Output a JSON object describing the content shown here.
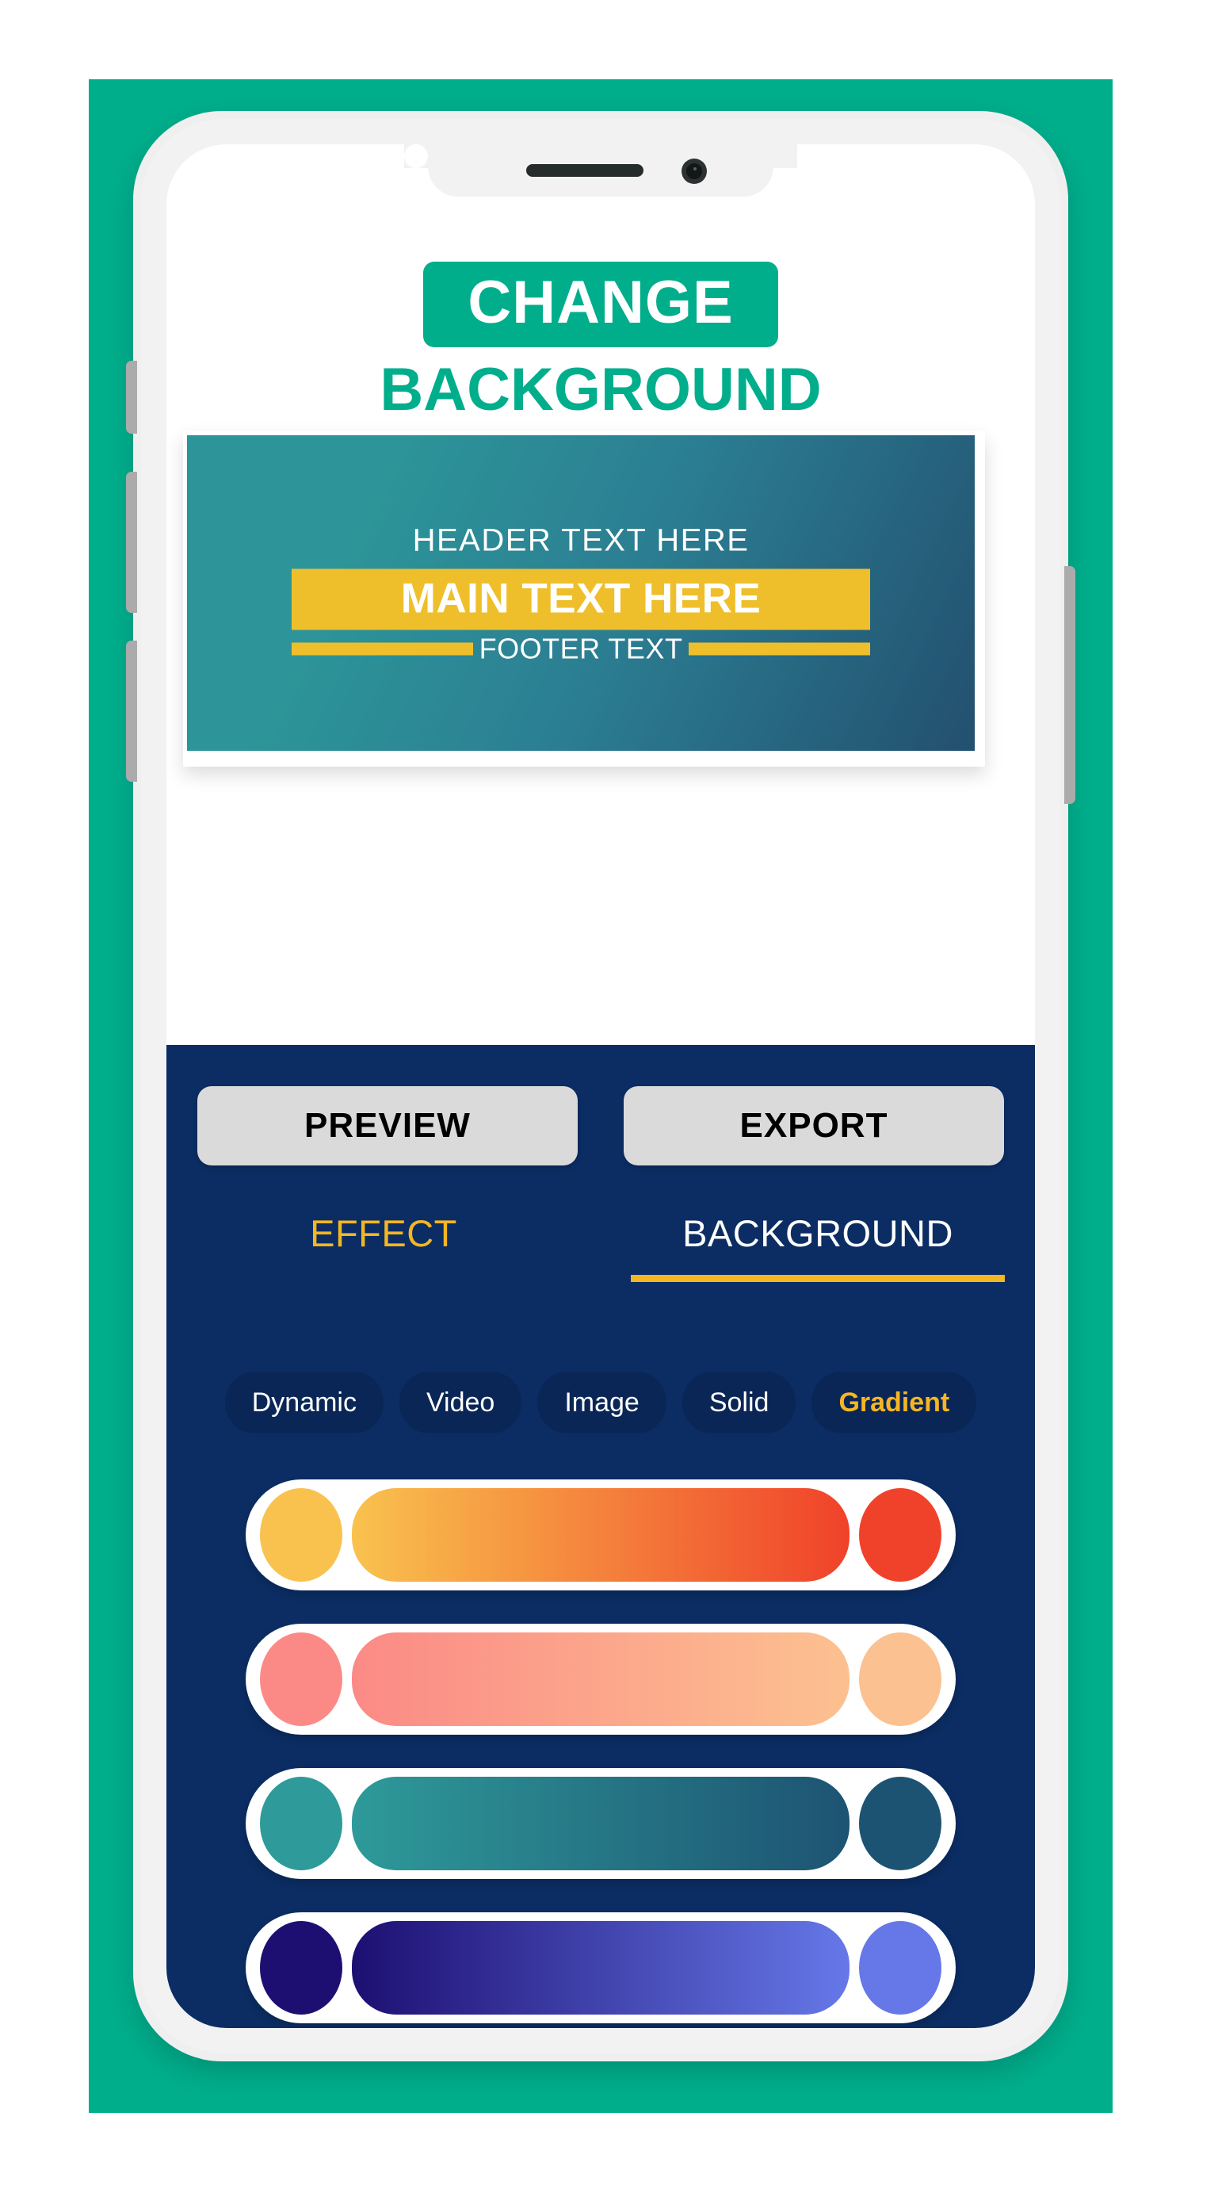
{
  "theme": {
    "brand_green": "#00AE8C",
    "panel_blue": "#0B2D63",
    "chip_blue": "#0A2656",
    "accent_yellow": "#F5B623",
    "card_band_yellow": "#EFBF2B",
    "button_grey": "#DADADA"
  },
  "title": {
    "line1": "CHANGE",
    "line2": "BACKGROUND"
  },
  "preview_card": {
    "header_text": "HEADER TEXT HERE",
    "main_text": "MAIN TEXT HERE",
    "footer_text": "FOOTER TEXT",
    "background_gradient_from": "#2D9599",
    "background_gradient_to": "#23506F"
  },
  "actions": {
    "preview_label": "PREVIEW",
    "export_label": "EXPORT"
  },
  "tabs": [
    {
      "label": "EFFECT",
      "active": false
    },
    {
      "label": "BACKGROUND",
      "active": true
    }
  ],
  "chips": [
    {
      "label": "Dynamic",
      "selected": false
    },
    {
      "label": "Video",
      "selected": false
    },
    {
      "label": "Image",
      "selected": false
    },
    {
      "label": "Solid",
      "selected": false
    },
    {
      "label": "Gradient",
      "selected": true
    }
  ],
  "gradients": [
    {
      "name": "sunset-orange",
      "start_color": "#F9C24E",
      "end_color": "#F0422A"
    },
    {
      "name": "salmon-peach",
      "start_color": "#FB8A86",
      "end_color": "#FCC190"
    },
    {
      "name": "teal-deep-blue",
      "start_color": "#2E9A99",
      "end_color": "#1D5372"
    },
    {
      "name": "indigo-periwinkle",
      "start_color": "#1D0F72",
      "end_color": "#6678E8"
    }
  ],
  "hardware": {
    "silence_switch": "silence-switch",
    "volume_up": "volume-up-button",
    "volume_down": "volume-down-button",
    "power": "power-button",
    "speaker": "earpiece-speaker",
    "camera": "front-camera"
  }
}
